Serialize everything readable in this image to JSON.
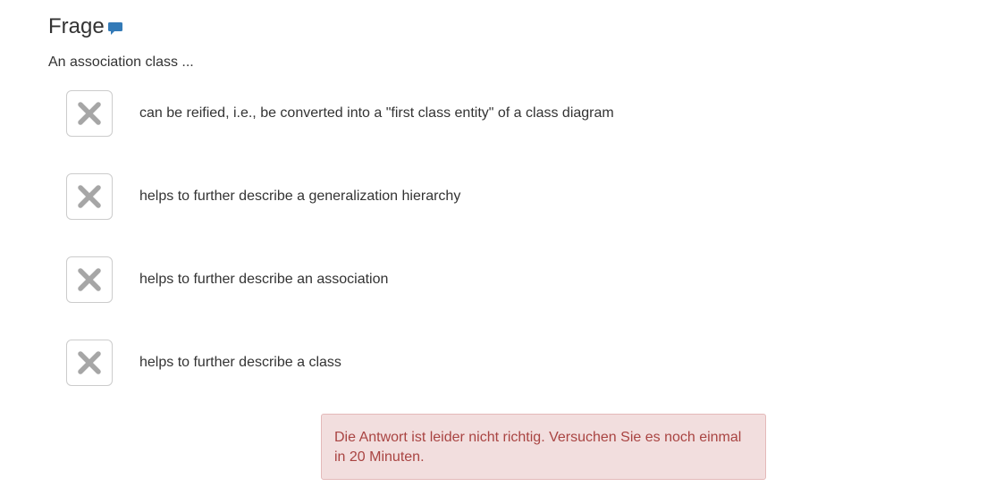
{
  "question": {
    "title": "Frage",
    "text": "An association class ...",
    "comment_icon": "comment-icon"
  },
  "answers": [
    {
      "label": "can be reified, i.e., be converted into a \"first class entity\" of a class diagram",
      "state": "incorrect",
      "icon": "x-icon"
    },
    {
      "label": "helps to further describe a generalization hierarchy",
      "state": "incorrect",
      "icon": "x-icon"
    },
    {
      "label": "helps to further describe an association",
      "state": "incorrect",
      "icon": "x-icon"
    },
    {
      "label": "helps to further describe a class",
      "state": "incorrect",
      "icon": "x-icon"
    }
  ],
  "feedback": {
    "message": "Die Antwort ist leider nicht richtig. Versuchen Sie es noch einmal in 20 Minuten."
  },
  "colors": {
    "comment_icon": "#337ab7",
    "x_icon": "#a6a6a6",
    "alert_background": "#f2dede",
    "alert_text": "#a94442"
  }
}
